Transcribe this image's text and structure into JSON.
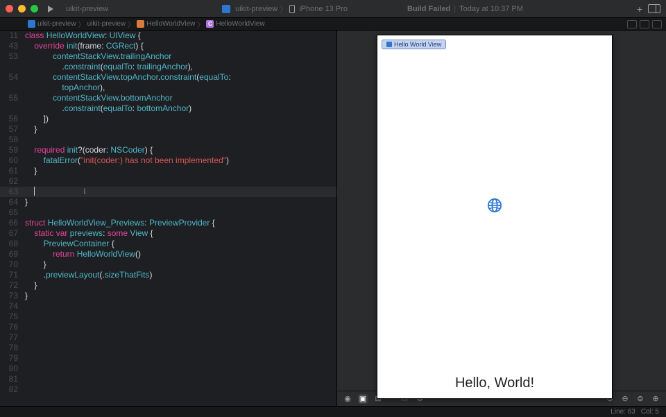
{
  "titlebar": {
    "project": "uikit-preview",
    "scheme": "uikit-preview",
    "device": "iPhone 13 Pro",
    "build_status": "Build Failed",
    "build_time": "Today at 10:37 PM"
  },
  "breadcrumb": {
    "items": [
      "uikit-preview",
      "uikit-preview",
      "HelloWorldView",
      "HelloWorldView"
    ]
  },
  "gutter": [
    "11",
    "43",
    "53",
    "",
    "54",
    "",
    "55",
    "",
    "56",
    "57",
    "58",
    "59",
    "60",
    "61",
    "62",
    "63",
    "64",
    "65",
    "66",
    "67",
    "68",
    "69",
    "70",
    "71",
    "72",
    "73",
    "74",
    "75",
    "76",
    "77",
    "78",
    "79",
    "80",
    "81",
    "82"
  ],
  "code": {
    "l0": {
      "a": "class ",
      "b": "HelloWorldView",
      "c": ": ",
      "d": "UIView",
      "e": " {"
    },
    "l1": {
      "a": "    override ",
      "b": "init",
      "c": "(frame: ",
      "d": "CGRect",
      "e": ") {"
    },
    "l2": {
      "a": "            ",
      "b": "contentStackView",
      "c": ".",
      "d": "trailingAnchor"
    },
    "l3": {
      "a": "                .",
      "b": "constraint",
      "c": "(",
      "d": "equalTo",
      "e": ": ",
      "f": "trailingAnchor",
      "g": "),"
    },
    "l4": {
      "a": "            ",
      "b": "contentStackView",
      "c": ".",
      "d": "topAnchor",
      "e": ".",
      "f": "constraint",
      "g": "(",
      "h": "equalTo",
      "i": ":"
    },
    "l5": {
      "a": "                ",
      "b": "topAnchor",
      "c": "),"
    },
    "l6": {
      "a": "            ",
      "b": "contentStackView",
      "c": ".",
      "d": "bottomAnchor"
    },
    "l7": {
      "a": "                .",
      "b": "constraint",
      "c": "(",
      "d": "equalTo",
      "e": ": ",
      "f": "bottomAnchor",
      "g": ")"
    },
    "l8": "        ])",
    "l9": "    }",
    "l10": "",
    "l11": {
      "a": "    required ",
      "b": "init",
      "c": "?(coder: ",
      "d": "NSCoder",
      "e": ") {"
    },
    "l12": {
      "a": "        ",
      "b": "fatalError",
      "c": "(",
      "d": "\"init(coder:) has not been implemented\"",
      "e": ")"
    },
    "l13": "    }",
    "l14": "",
    "l15": "    ",
    "l16": "}",
    "l17": "",
    "l18": {
      "a": "struct ",
      "b": "HelloWorldView_Previews",
      "c": ": ",
      "d": "PreviewProvider",
      "e": " {"
    },
    "l19": {
      "a": "    static ",
      "b": "var ",
      "c": "previews",
      "d": ": ",
      "e": "some ",
      "f": "View",
      "g": " {"
    },
    "l20": {
      "a": "        ",
      "b": "PreviewContainer",
      "c": " {"
    },
    "l21": {
      "a": "            return ",
      "b": "HelloWorldView",
      "c": "()"
    },
    "l22": "        }",
    "l23": {
      "a": "        .",
      "b": "previewLayout",
      "c": "(.",
      "d": "sizeThatFits",
      "e": ")"
    },
    "l24": "    }",
    "l25": "}",
    "l26": "",
    "l27": "",
    "l28": "",
    "l29": "",
    "l30": "",
    "l31": "",
    "l32": "",
    "l33": ""
  },
  "preview": {
    "badge": "Hello World View",
    "label": "Hello, World!"
  },
  "status": {
    "line": "Line: 63",
    "col": "Col: 5"
  }
}
